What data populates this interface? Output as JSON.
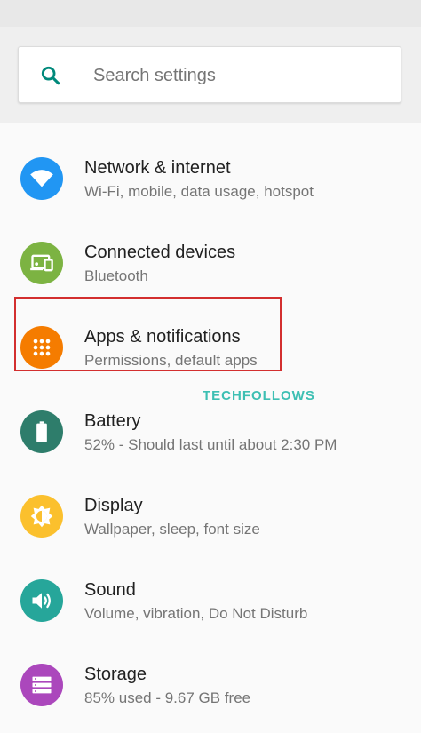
{
  "search": {
    "placeholder": "Search settings",
    "icon": "search-icon",
    "icon_color": "#00897b"
  },
  "items": [
    {
      "title": "Network & internet",
      "subtitle": "Wi-Fi, mobile, data usage, hotspot",
      "icon": "wifi-icon",
      "color": "#2196f3"
    },
    {
      "title": "Connected devices",
      "subtitle": "Bluetooth",
      "icon": "devices-icon",
      "color": "#7cb342"
    },
    {
      "title": "Apps & notifications",
      "subtitle": "Permissions, default apps",
      "icon": "apps-icon",
      "color": "#f57c00"
    },
    {
      "title": "Battery",
      "subtitle": "52% - Should last until about 2:30 PM",
      "icon": "battery-icon",
      "color": "#2e7d6b"
    },
    {
      "title": "Display",
      "subtitle": "Wallpaper, sleep, font size",
      "icon": "brightness-icon",
      "color": "#fbc02d"
    },
    {
      "title": "Sound",
      "subtitle": "Volume, vibration, Do Not Disturb",
      "icon": "volume-icon",
      "color": "#26a69a"
    },
    {
      "title": "Storage",
      "subtitle": "85% used - 9.67 GB free",
      "icon": "storage-icon",
      "color": "#ab47bc"
    }
  ],
  "highlight_color": "#d32f2f",
  "watermark": "TECHFOLLOWS"
}
